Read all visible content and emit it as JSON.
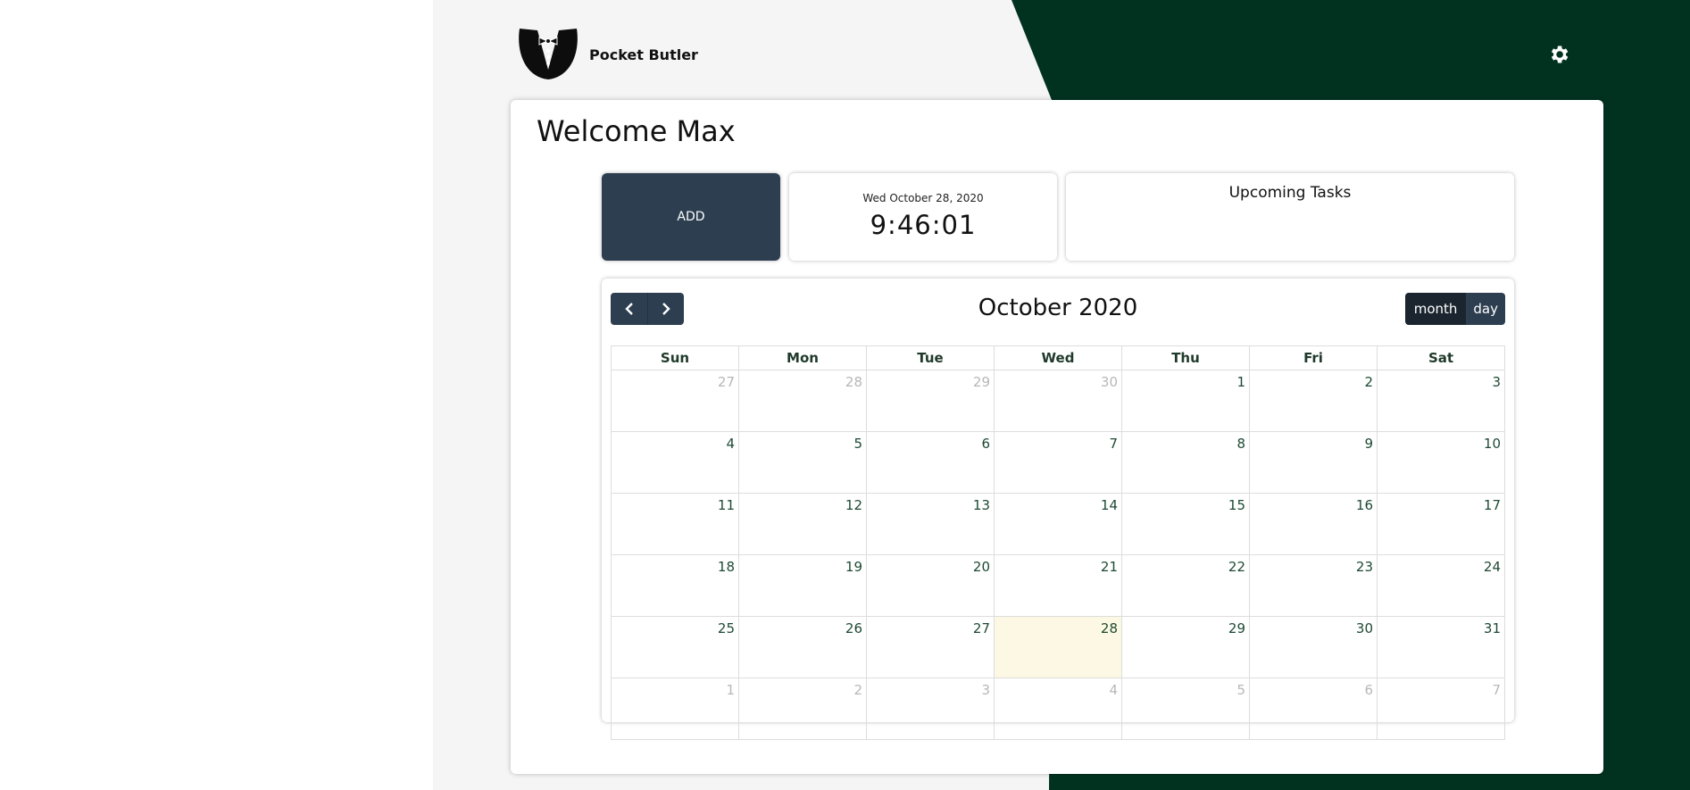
{
  "header": {
    "brand": "Pocket Butler",
    "logo_icon": "tuxedo-icon",
    "settings_icon": "gear-icon"
  },
  "colors": {
    "accent": "#2c3e50",
    "brand_green": "#013220",
    "today": "#fcf8e3"
  },
  "welcome": "Welcome Max",
  "add_button": "ADD",
  "clock": {
    "date": "Wed October 28, 2020",
    "time": "9:46:01"
  },
  "tasks": {
    "title": "Upcoming Tasks"
  },
  "calendar": {
    "title": "October 2020",
    "views": {
      "month": "month",
      "day": "day"
    },
    "weekdays": [
      "Sun",
      "Mon",
      "Tue",
      "Wed",
      "Thu",
      "Fri",
      "Sat"
    ],
    "weeks": [
      [
        "27",
        "28",
        "29",
        "30",
        "1",
        "2",
        "3"
      ],
      [
        "4",
        "5",
        "6",
        "7",
        "8",
        "9",
        "10"
      ],
      [
        "11",
        "12",
        "13",
        "14",
        "15",
        "16",
        "17"
      ],
      [
        "18",
        "19",
        "20",
        "21",
        "22",
        "23",
        "24"
      ],
      [
        "25",
        "26",
        "27",
        "28",
        "29",
        "30",
        "31"
      ],
      [
        "1",
        "2",
        "3",
        "4",
        "5",
        "6",
        "7"
      ]
    ]
  }
}
